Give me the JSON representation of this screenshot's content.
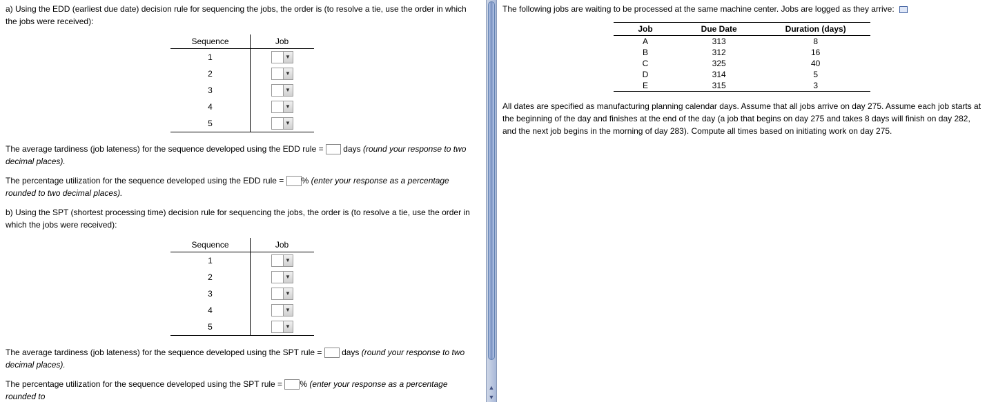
{
  "left": {
    "a_intro": "a) Using the EDD (earliest due date) decision rule for sequencing the jobs, the order is (to resolve a tie, use the order in which the jobs were received):",
    "seq_header_1": "Sequence",
    "seq_header_2": "Job",
    "sequences": [
      "1",
      "2",
      "3",
      "4",
      "5"
    ],
    "tardiness_edd_1": "The average tardiness (job lateness) for the sequence developed using the EDD rule = ",
    "tardiness_edd_2": " days ",
    "tardiness_edd_3": "(round your response to two decimal places).",
    "util_edd_1": "The percentage utilization for the sequence developed using the EDD rule = ",
    "util_edd_2": "% ",
    "util_edd_3": "(enter your response as a percentage rounded to two decimal places).",
    "b_intro": "b) Using the SPT (shortest processing time) decision rule for sequencing the jobs, the order is (to resolve a tie, use the order in which the jobs were received):",
    "tardiness_spt_1": "The average tardiness (job lateness) for the sequence developed using the SPT rule = ",
    "tardiness_spt_2": " days ",
    "tardiness_spt_3": "(round your response to two decimal places).",
    "util_spt_1": "The percentage utilization for the sequence developed using the SPT rule = ",
    "util_spt_2": "% ",
    "util_spt_3": "(enter your response as a percentage rounded to"
  },
  "right": {
    "intro": "The following jobs are waiting to be processed at the same machine center. Jobs are logged as they arrive:",
    "headers": {
      "job": "Job",
      "due": "Due Date",
      "dur": "Duration (days)"
    },
    "rows": [
      {
        "job": "A",
        "due": "313",
        "dur": "8"
      },
      {
        "job": "B",
        "due": "312",
        "dur": "16"
      },
      {
        "job": "C",
        "due": "325",
        "dur": "40"
      },
      {
        "job": "D",
        "due": "314",
        "dur": "5"
      },
      {
        "job": "E",
        "due": "315",
        "dur": "3"
      }
    ],
    "note": "All dates are specified as manufacturing planning calendar days. Assume that all jobs arrive on day 275. Assume each job starts at the beginning of the day and finishes at the end of the day (a job that begins on day 275 and takes 8 days will finish on day 282, and the next job begins in the morning of day 283). Compute all times based on initiating work on day 275."
  }
}
